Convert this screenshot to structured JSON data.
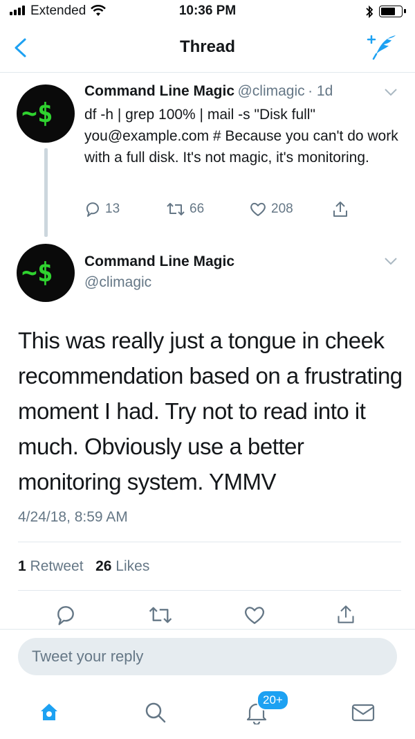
{
  "status_bar": {
    "carrier": "Extended",
    "time": "10:36 PM"
  },
  "nav": {
    "title": "Thread"
  },
  "parent_tweet": {
    "avatar_text": "~$",
    "name": "Command Line Magic",
    "handle": "@climagic",
    "age": "· 1d",
    "text": "df -h | grep 100% | mail -s \"Disk full\" you@example.com # Because you can't do work with a full disk. It's not magic, it's monitoring.",
    "replies": "13",
    "retweets": "66",
    "likes": "208"
  },
  "main_tweet": {
    "avatar_text": "~$",
    "name": "Command Line Magic",
    "handle": "@climagic",
    "text": "This was really just a tongue in cheek recommendation based on a frustrating moment I had. Try not to read into it much. Obviously use a better monitoring system. YMMV",
    "date": "4/24/18, 8:59 AM",
    "retweet_count": "1",
    "retweet_label": "Retweet",
    "like_count": "26",
    "like_label": "Likes"
  },
  "reply": {
    "placeholder": "Tweet your reply"
  },
  "tabbar": {
    "notifications_badge": "20+"
  },
  "colors": {
    "accent": "#1da1f2",
    "muted": "#657786",
    "terminal_green": "#2fd32f"
  }
}
